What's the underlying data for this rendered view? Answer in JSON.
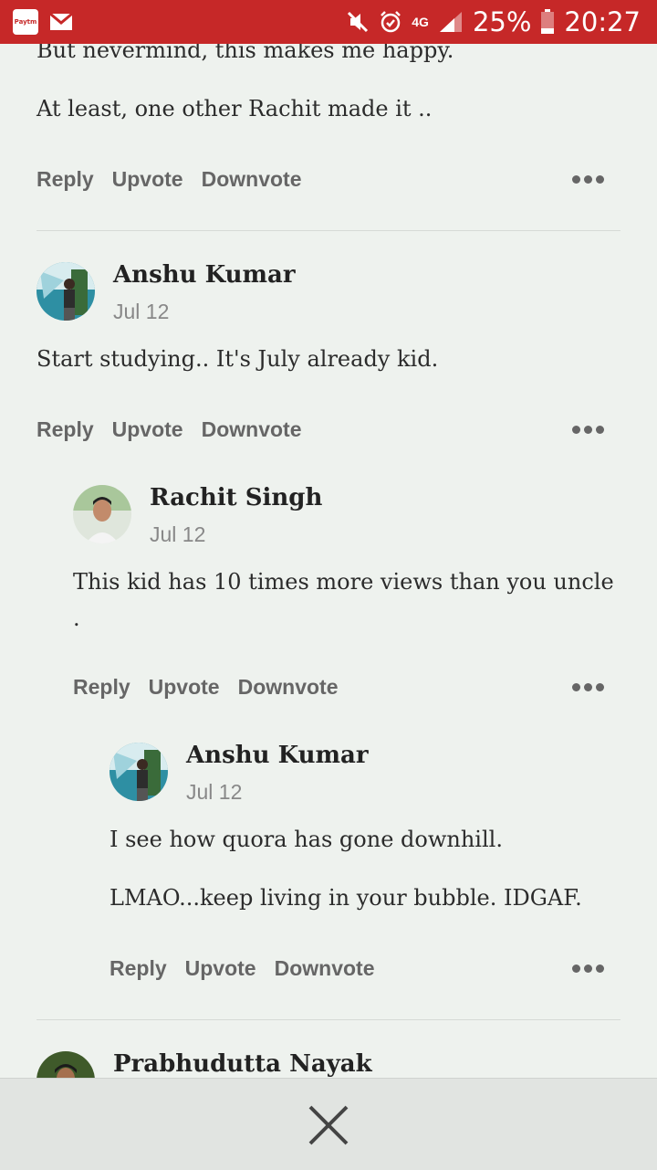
{
  "status_bar": {
    "left_icons": [
      "paytm-icon",
      "gmail-icon"
    ],
    "paytm_label": "Paytm",
    "network": "4G",
    "battery": "25%",
    "time": "20:27"
  },
  "top_comment": {
    "line1": "But nevermind, this makes me happy.",
    "line2": "At least, one other Rachit made it .."
  },
  "actions": {
    "reply": "Reply",
    "upvote": "Upvote",
    "downvote": "Downvote"
  },
  "comments": [
    {
      "author": "Anshu Kumar",
      "date": "Jul 12",
      "text": "Start studying..  It's July already kid."
    },
    {
      "author": "Rachit Singh",
      "date": "Jul 12",
      "text_line1": "This kid has 10 times more views than you uncle",
      "text_line2": "."
    },
    {
      "author": "Anshu Kumar",
      "date": "Jul 12",
      "text_line1": "I see how quora has gone downhill.",
      "text_line2": "LMAO...keep living in your bubble. IDGAF."
    },
    {
      "author": "Prabhudutta Nayak"
    }
  ],
  "colors": {
    "status_bar": "#c62828",
    "background": "#eef2ee",
    "bottom_bar": "#e1e4e1"
  }
}
